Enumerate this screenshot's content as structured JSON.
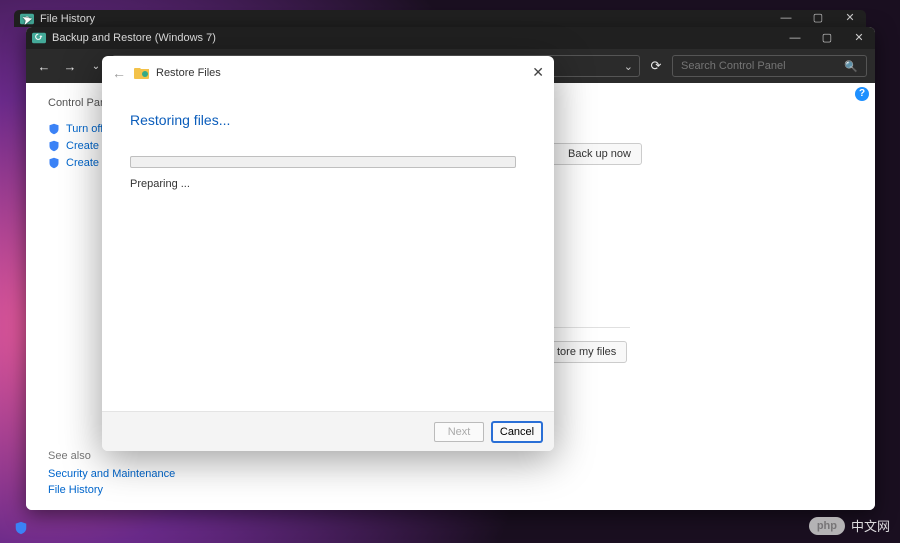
{
  "win1": {
    "title": "File History"
  },
  "win2": {
    "title": "Backup and Restore (Windows 7)",
    "search_placeholder": "Search Control Panel",
    "cp_home": "Control Panel",
    "tasks": [
      "Turn off sche",
      "Create a syste",
      "Create a syste"
    ],
    "backup_now": "Back up now",
    "restore_my_files": "tore my files",
    "see_also_header": "See also",
    "see_also": [
      "Security and Maintenance",
      "File History"
    ]
  },
  "dialog": {
    "title": "Restore Files",
    "heading": "Restoring files...",
    "status": "Preparing ...",
    "next": "Next",
    "cancel": "Cancel"
  },
  "watermark": {
    "php": "php",
    "cn": "中文网"
  }
}
